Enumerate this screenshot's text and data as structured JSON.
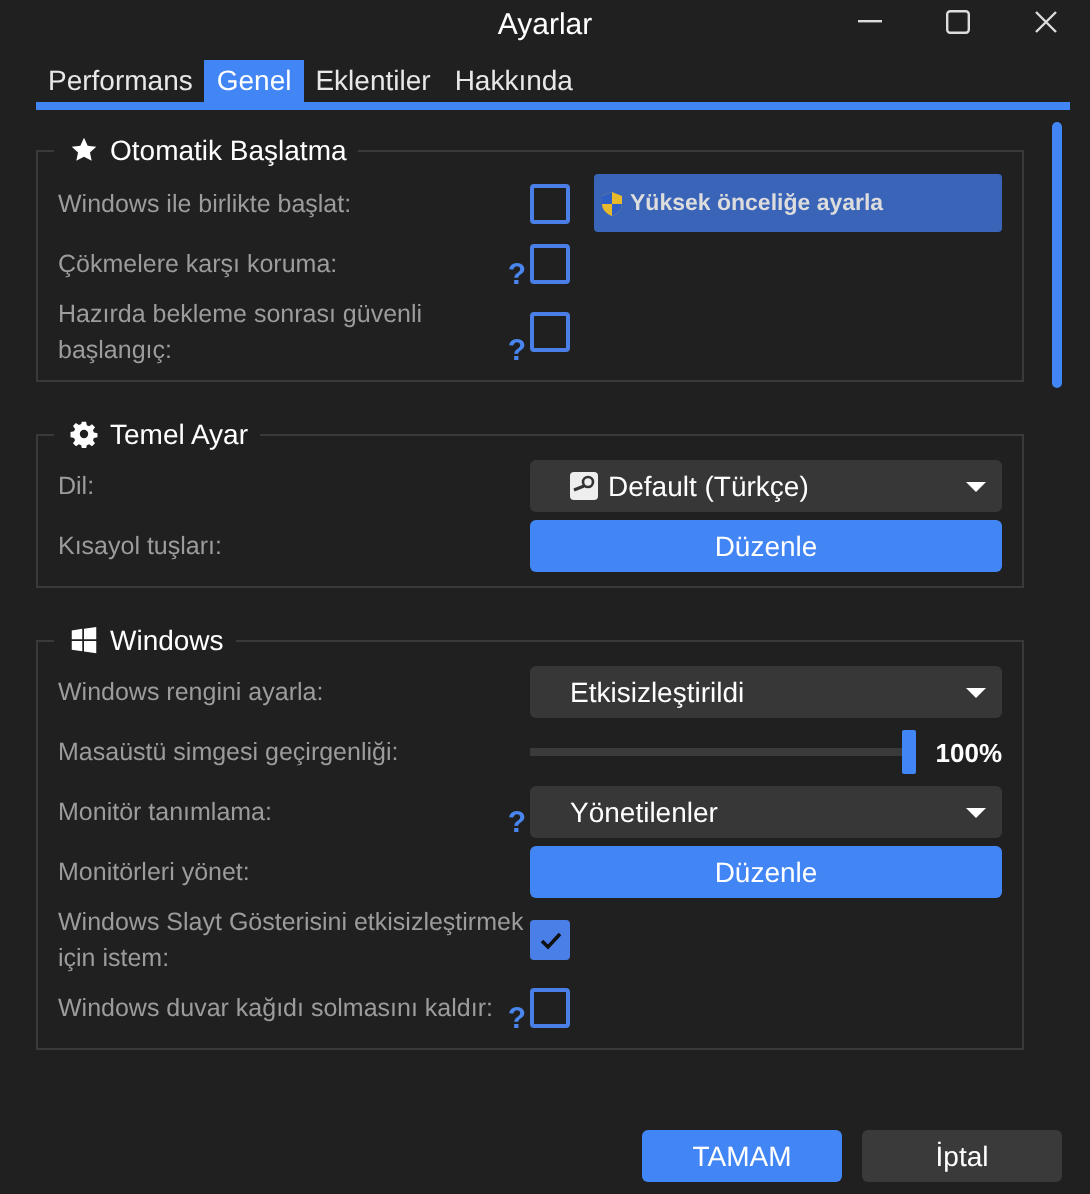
{
  "window": {
    "title": "Ayarlar"
  },
  "tabs": [
    {
      "label": "Performans",
      "selected": false
    },
    {
      "label": "Genel",
      "selected": true
    },
    {
      "label": "Eklentiler",
      "selected": false
    },
    {
      "label": "Hakkında",
      "selected": false
    }
  ],
  "sections": [
    {
      "title": "Otomatik Başlatma",
      "rows": [
        {
          "kind": "checkbox",
          "label": "Windows ile birlikte başlat:",
          "help": false,
          "checked": false,
          "side_button": "Yüksek önceliğe ayarla"
        },
        {
          "kind": "checkbox",
          "label": "Çökmelere karşı koruma:",
          "help": true,
          "checked": false
        },
        {
          "kind": "checkbox",
          "label": "Hazırda bekleme sonrası güvenli başlangıç:",
          "help": true,
          "checked": false
        }
      ]
    },
    {
      "title": "Temel Ayar",
      "rows": [
        {
          "kind": "dropdown",
          "label": "Dil:",
          "help": false,
          "value": "Default (Türkçe)",
          "value_icon": true
        },
        {
          "kind": "button",
          "label": "Kısayol tuşları:",
          "help": false,
          "button": "Düzenle"
        }
      ]
    },
    {
      "title": "Windows",
      "rows": [
        {
          "kind": "dropdown",
          "label": "Windows rengini ayarla:",
          "help": false,
          "value": "Etkisizleştirildi"
        },
        {
          "kind": "slider",
          "label": "Masaüstü simgesi geçirgenliği:",
          "help": false,
          "level": 1,
          "reading": "100%"
        },
        {
          "kind": "dropdown",
          "label": "Monitör tanımlama:",
          "help": true,
          "value": "Yönetilenler"
        },
        {
          "kind": "button",
          "label": "Monitörleri yönet:",
          "help": false,
          "button": "Düzenle"
        },
        {
          "kind": "checkbox",
          "label": "Windows Slayt Gösterisini etkisizleştirmek için istem:",
          "help": false,
          "checked": true
        },
        {
          "kind": "checkbox",
          "label": "Windows duvar kağıdı solmasını kaldır:",
          "help": true,
          "checked": false
        }
      ]
    }
  ],
  "help_mark": "?",
  "footer": [
    {
      "label": "TAMAM",
      "kind": "primary"
    },
    {
      "label": "İptal",
      "kind": "secondary"
    }
  ]
}
